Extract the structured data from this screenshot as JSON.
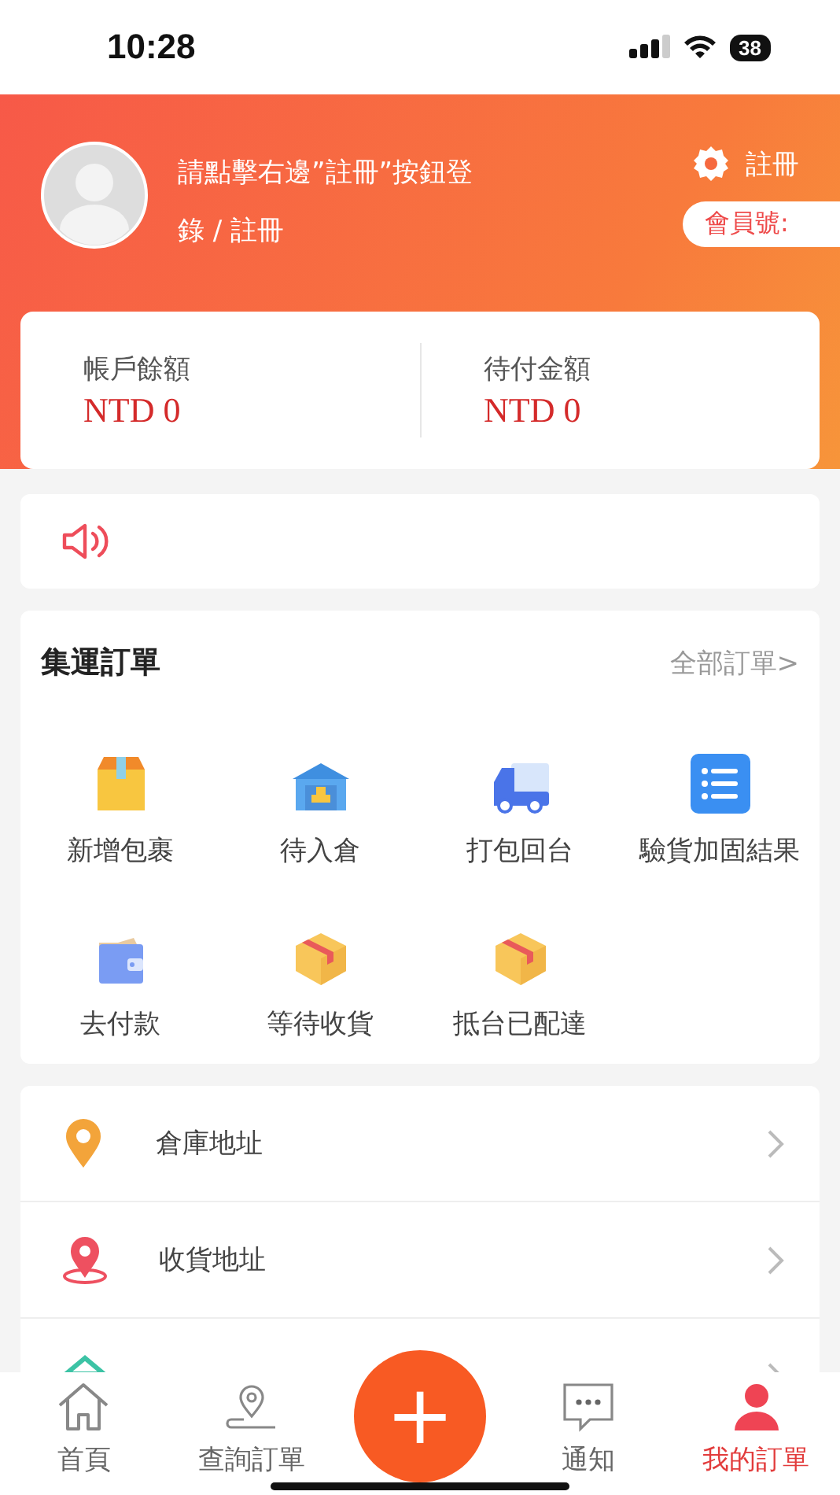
{
  "status_bar": {
    "time": "10:28",
    "battery": "38"
  },
  "profile": {
    "prompt_lines": [
      "請點擊右邊”註冊”按鈕登",
      "錄 / 註冊"
    ],
    "register": "註冊",
    "member_no": "會員號:"
  },
  "balances": [
    {
      "label": "帳戶餘額",
      "value": "NTD 0"
    },
    {
      "label": "待付金額",
      "value": "NTD 0"
    }
  ],
  "orders": {
    "title": "集運訂單",
    "all_link": "全部訂單>",
    "items": [
      {
        "label": "新增包裹",
        "kind": "box-open"
      },
      {
        "label": "待入倉",
        "kind": "warehouse"
      },
      {
        "label": "打包回台",
        "kind": "truck"
      },
      {
        "label": "驗貨加固結果",
        "kind": "list"
      },
      {
        "label": "去付款",
        "kind": "wallet"
      },
      {
        "label": "等待收貨",
        "kind": "box"
      },
      {
        "label": "抵台已配達",
        "kind": "box"
      }
    ]
  },
  "menu": [
    {
      "label": "倉庫地址",
      "kind": "pin"
    },
    {
      "label": "收貨地址",
      "kind": "pin-ring"
    },
    {
      "kind": "hanger"
    }
  ],
  "tabs": [
    {
      "label": "首頁",
      "kind": "home",
      "selected": false
    },
    {
      "label": "查詢訂單",
      "kind": "track",
      "selected": false
    },
    {
      "label": "通知",
      "kind": "chat",
      "selected": false
    },
    {
      "label": "我的訂單",
      "kind": "user",
      "selected": true
    }
  ],
  "fab": "+"
}
